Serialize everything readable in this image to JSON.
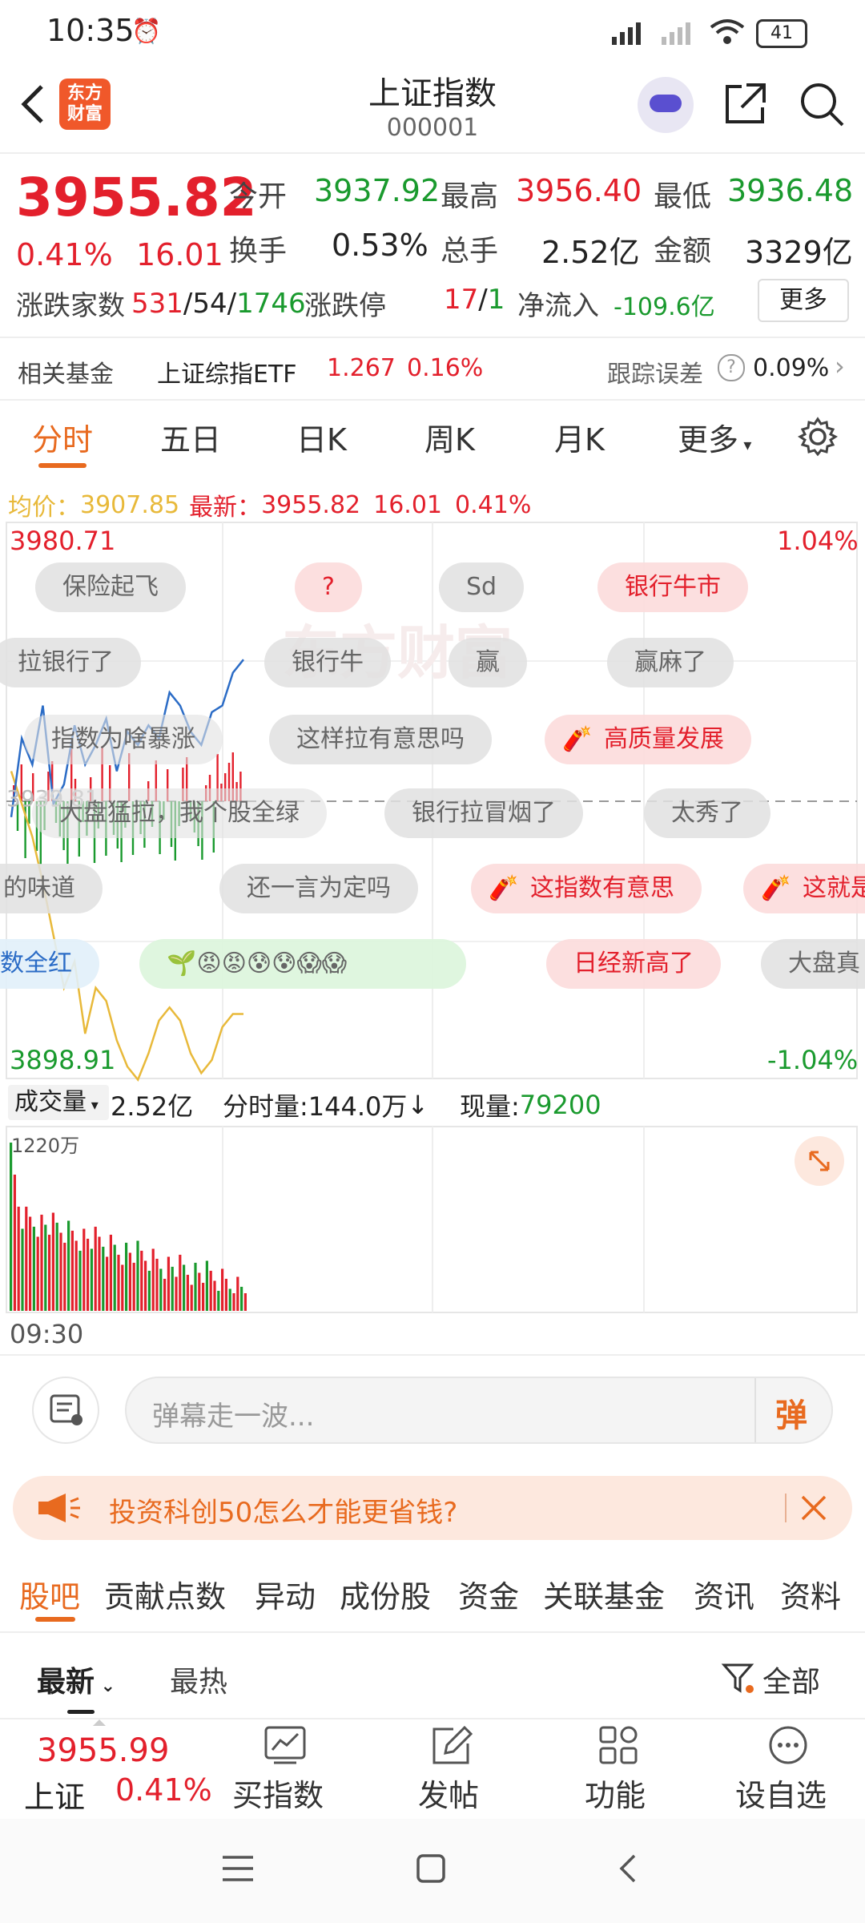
{
  "status": {
    "time": "10:35",
    "battery": "41"
  },
  "header": {
    "title": "上证指数",
    "code": "000001",
    "logo_line1": "东方",
    "logo_line2": "财富"
  },
  "quote": {
    "price": "3955.82",
    "pct": "0.41%",
    "chg": "16.01",
    "open_label": "今开",
    "open": "3937.92",
    "high_label": "最高",
    "high": "3956.40",
    "low_label": "最低",
    "low": "3936.48",
    "turnover_label": "换手",
    "turnover": "0.53%",
    "volume_label": "总手",
    "volume": "2.52亿",
    "amount_label": "金额",
    "amount": "3329亿",
    "advdec_label": "涨跌家数",
    "adv": "531",
    "flat": "54",
    "dec": "1746",
    "sep": "/",
    "limit_label": "涨跌停",
    "limit_up": "17",
    "limit_down": "1",
    "inflow_label": "净流入",
    "inflow": "-109.6亿",
    "more_button": "更多"
  },
  "fund": {
    "label": "相关基金",
    "name": "上证综指ETF",
    "price": "1.267",
    "pct": "0.16%",
    "track_label": "跟踪误差",
    "track_value": "0.09%"
  },
  "chart_tabs": [
    "分时",
    "五日",
    "日K",
    "周K",
    "月K",
    "更多"
  ],
  "info_line": {
    "avg_label": "均价：",
    "avg": "3907.85",
    "latest_label": "最新：",
    "latest": "3955.82",
    "chg": "16.01",
    "pct": "0.41%"
  },
  "chart_labels": {
    "top_price": "3980.71",
    "top_pct": "1.04%",
    "bottom_price": "3898.91",
    "bottom_pct": "-1.04%",
    "watermark": "东方财富",
    "mid_price": "3939.81"
  },
  "danmaku": [
    "保险起飞",
    "?",
    "Sd",
    "银行牛市",
    "拉银行了",
    "银行牛",
    "赢",
    "赢麻了",
    "指数为啥暴涨",
    "这样拉有意思吗",
    "高质量发展",
    "大盘猛拉，我个股全绿",
    "银行拉冒烟了",
    "太秀了",
    "的味道",
    "还一言为定吗",
    "这指数有意思",
    "这就是",
    "数全红",
    "日经新高了",
    "大盘真"
  ],
  "volume_bar": {
    "label": "成交量",
    "total": "2.52亿",
    "minute_label": "分时量:",
    "minute": "144.0万",
    "arrow": "↓",
    "current_label": "现量:",
    "current": "79200",
    "axis_max": "1220万",
    "time_start": "09:30"
  },
  "comment": {
    "placeholder": "弹幕走一波...",
    "danmaku_btn": "弹"
  },
  "ad": {
    "text": "投资科创50怎么才能更省钱?"
  },
  "section_tabs": [
    "股吧",
    "贡献点数",
    "异动",
    "成份股",
    "资金",
    "关联基金",
    "资讯",
    "资料"
  ],
  "sort": {
    "latest": "最新",
    "hot": "最热",
    "filter": "全部"
  },
  "bottom": {
    "price": "3955.99",
    "name": "上证",
    "pct": "0.41%",
    "buy": "买指数",
    "post": "发帖",
    "func": "功能",
    "watch": "设自选"
  },
  "chart_data": {
    "type": "line",
    "title": "",
    "ylim": [
      3898.91,
      3980.71
    ],
    "series": [
      {
        "name": "price",
        "values": [
          3938,
          3950,
          3946,
          3955,
          3940,
          3943,
          3952,
          3946,
          3949,
          3953,
          3945,
          3951,
          3949,
          3952,
          3950,
          3957,
          3955,
          3951,
          3949,
          3954,
          3955,
          3960,
          3962
        ]
      },
      {
        "name": "avg",
        "values": [
          3945,
          3940,
          3935,
          3928,
          3920,
          3912,
          3916,
          3905,
          3912,
          3910,
          3904,
          3900,
          3898,
          3902,
          3907,
          3909,
          3907,
          3902,
          3899,
          3901,
          3906,
          3908,
          3908
        ]
      }
    ]
  }
}
